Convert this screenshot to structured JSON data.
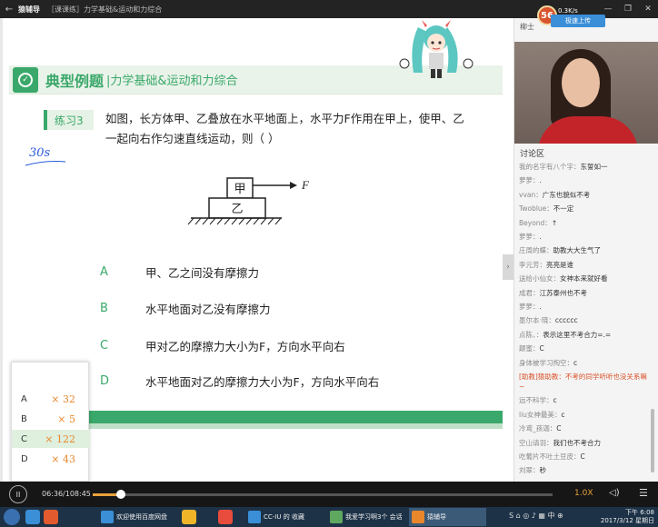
{
  "titlebar": {
    "app": "猿辅导",
    "course": "［课课练］力学基础&运动和力综合"
  },
  "slide": {
    "header_title": "典型例题",
    "header_sub": "|力学基础&运动和力综合",
    "exercise_tag": "练习3",
    "question_line1": "如图，长方体甲、乙叠放在水平地面上，水平力F作用在甲上，使甲、乙",
    "question_line2": "一起向右作匀速直线运动，则（        ）",
    "handwriting": "30s",
    "diagram": {
      "top_label": "甲",
      "bottom_label": "乙",
      "force_label": "F"
    },
    "options": [
      {
        "letter": "A",
        "text": "甲、乙之间没有摩擦力"
      },
      {
        "letter": "B",
        "text": "水平地面对乙没有摩擦力"
      },
      {
        "letter": "C",
        "text": "甲对乙的摩擦力大小为F，方向水平向右"
      },
      {
        "letter": "D",
        "text": "水平地面对乙的摩擦力大小为F，方向水平向右"
      }
    ]
  },
  "answer_stats": [
    {
      "letter": "A",
      "count": "× 32"
    },
    {
      "letter": "B",
      "count": "× 5"
    },
    {
      "letter": "C",
      "count": "× 122"
    },
    {
      "letter": "D",
      "count": "× 43"
    }
  ],
  "right_panel": {
    "badge": "56",
    "speed": "0.3K/s",
    "upload_label": "极速上传",
    "teacher_name": "柳士",
    "discuss_title": "讨论区",
    "chat": [
      {
        "name": "我的名字有八个字：",
        "msg": "东誓如一"
      },
      {
        "name": "萝萝：",
        "msg": "."
      },
      {
        "name": "vvan：",
        "msg": "广东也貌似不考"
      },
      {
        "name": "Twoblue：",
        "msg": "不一定"
      },
      {
        "name": "Beyond：",
        "msg": "↑"
      },
      {
        "name": "萝萝：",
        "msg": "."
      },
      {
        "name": "庄周的蝶：",
        "msg": "助教大大生气了"
      },
      {
        "name": "李元芳：",
        "msg": "亮亮是谁"
      },
      {
        "name": "送给小仙女：",
        "msg": "女神本来就好看"
      },
      {
        "name": "成君：",
        "msg": "江苏泰州也不考"
      },
      {
        "name": "萝萝：",
        "msg": "."
      },
      {
        "name": "墨尔本·晓：",
        "msg": "cccccc"
      },
      {
        "name": "点陈、：",
        "msg": "表示这里不考合力=.="
      },
      {
        "name": "颠蜜：",
        "msg": "C"
      },
      {
        "name": "身体被学习掏空：",
        "msg": "c"
      },
      {
        "name": "[助教]猿助教：",
        "msg": "不考的同学听听也没关系嘛~",
        "red": true
      },
      {
        "name": "远不科学：",
        "msg": "c"
      },
      {
        "name": "liu女神最美：",
        "msg": "c"
      },
      {
        "name": "冷鸢_孩迦：",
        "msg": "C"
      },
      {
        "name": "空山请羽：",
        "msg": "我们也不考合力"
      },
      {
        "name": "吃葡片不吐土豆皮：",
        "msg": "C"
      },
      {
        "name": "刘翠：",
        "msg": "秒"
      }
    ]
  },
  "player": {
    "play_icon": "II",
    "time": "06:36/108:45",
    "progress": 0.061,
    "rate": "1.0X"
  },
  "taskbar": {
    "items": [
      "欢迎使用百度网盘",
      "CC-IU 的 收藏",
      "我爱学习啊3个 会话",
      "猿辅导"
    ],
    "clock_time": "下午 6:08",
    "clock_date": "2017/3/12 星期日"
  }
}
